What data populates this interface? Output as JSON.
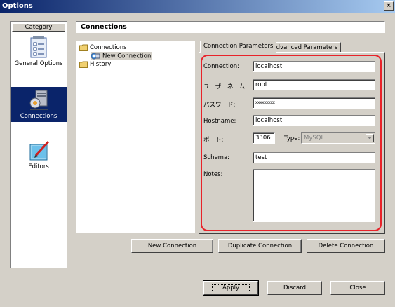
{
  "window": {
    "title": "Options",
    "close_glyph": "×"
  },
  "category": {
    "header": "Category",
    "items": [
      {
        "label": "General Options",
        "icon": "general-options-icon",
        "selected": false
      },
      {
        "label": "Connections",
        "icon": "connections-icon",
        "selected": true
      },
      {
        "label": "Editors",
        "icon": "editors-icon",
        "selected": false
      }
    ]
  },
  "section_title": "Connections",
  "tree": {
    "items": [
      {
        "label": "Connections",
        "icon": "folder-icon"
      },
      {
        "label": "New Connection",
        "icon": "connection-icon"
      },
      {
        "label": "History",
        "icon": "folder-icon"
      }
    ]
  },
  "tabs": [
    {
      "label": "Connection Parameters",
      "active": true
    },
    {
      "label": "Advanced Parameters",
      "active": false
    }
  ],
  "form": {
    "connection_label": "Connection:",
    "connection_value": "localhost",
    "username_label": "ユーザーネーム:",
    "username_value": "root",
    "password_label": "パスワード:",
    "password_value": "xxxxxxxxx",
    "hostname_label": "Hostname:",
    "hostname_value": "localhost",
    "port_label": "ポート:",
    "port_value": "3306",
    "type_label": "Type:",
    "type_value": "MySQL",
    "schema_label": "Schema:",
    "schema_value": "test",
    "notes_label": "Notes:",
    "notes_value": ""
  },
  "buttons": {
    "new_connection": "New Connection",
    "duplicate_connection": "Duplicate Connection",
    "delete_connection": "Delete Connection",
    "apply": "Apply",
    "discard": "Discard",
    "close": "Close"
  },
  "colors": {
    "title_bar": "#0a246a",
    "selection": "#0a246a",
    "highlight_border": "#e8232a",
    "dialog_face": "#d4d0c8"
  }
}
